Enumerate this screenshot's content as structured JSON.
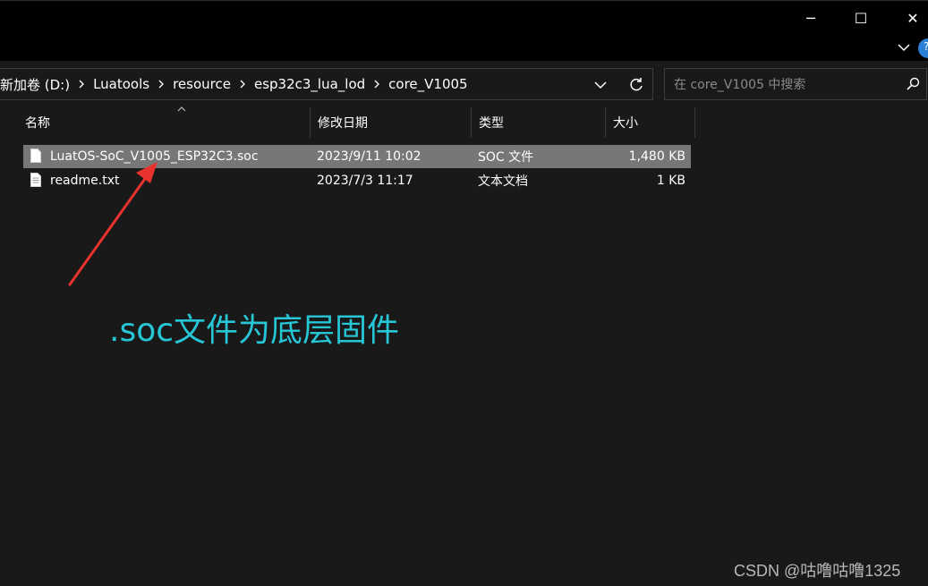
{
  "window": {
    "minimize": "─",
    "maximize": "☐",
    "close": "✕"
  },
  "address": {
    "crumbs": [
      "新加卷 (D:)",
      "Luatools",
      "resource",
      "esp32c3_lua_lod",
      "core_V1005"
    ]
  },
  "search": {
    "placeholder": "在 core_V1005 中搜索"
  },
  "columns": {
    "name": "名称",
    "date": "修改日期",
    "type": "类型",
    "size": "大小"
  },
  "files": [
    {
      "name": "LuatOS-SoC_V1005_ESP32C3.soc",
      "date": "2023/9/11 10:02",
      "type": "SOC 文件",
      "size": "1,480 KB",
      "selected": true
    },
    {
      "name": "readme.txt",
      "date": "2023/7/3 11:17",
      "type": "文本文档",
      "size": "1 KB",
      "selected": false
    }
  ],
  "annotation": {
    "text": ".soc文件为底层固件",
    "color": "#27c6d6",
    "arrow_color": "#e8322d"
  },
  "watermark": "CSDN @咕噜咕噜1325",
  "colors": {
    "background": "#191919",
    "titlebar": "#000000",
    "selection": "#777777",
    "help_accent": "#2b7fd6"
  },
  "icons": [
    "minimize-icon",
    "maximize-icon",
    "close-icon",
    "chevron-down-icon",
    "help-icon",
    "chevron-right-icon",
    "refresh-icon",
    "search-icon",
    "sort-up-icon",
    "file-icon"
  ]
}
